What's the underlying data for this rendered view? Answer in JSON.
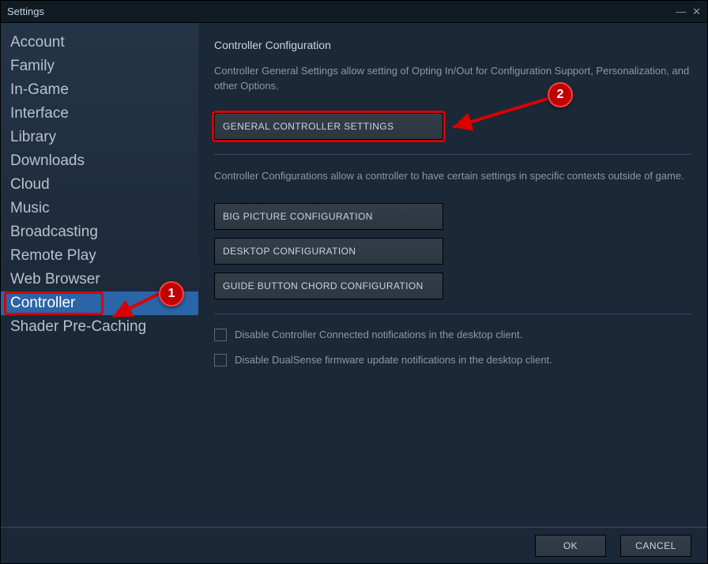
{
  "window": {
    "title": "Settings"
  },
  "sidebar": {
    "items": [
      {
        "label": "Account"
      },
      {
        "label": "Family"
      },
      {
        "label": "In-Game"
      },
      {
        "label": "Interface"
      },
      {
        "label": "Library"
      },
      {
        "label": "Downloads"
      },
      {
        "label": "Cloud"
      },
      {
        "label": "Music"
      },
      {
        "label": "Broadcasting"
      },
      {
        "label": "Remote Play"
      },
      {
        "label": "Web Browser"
      },
      {
        "label": "Controller"
      },
      {
        "label": "Shader Pre-Caching"
      }
    ],
    "selected_index": 11
  },
  "main": {
    "heading": "Controller Configuration",
    "intro": "Controller General Settings allow setting of Opting In/Out for Configuration Support, Personalization, and other Options.",
    "buttons": {
      "general": "GENERAL CONTROLLER SETTINGS",
      "big_picture": "BIG PICTURE CONFIGURATION",
      "desktop": "DESKTOP CONFIGURATION",
      "guide_chord": "GUIDE BUTTON CHORD CONFIGURATION"
    },
    "section_desc": "Controller Configurations allow a controller to have certain settings in specific contexts outside of game.",
    "checkboxes": {
      "disable_connected": "Disable Controller Connected notifications in the desktop client.",
      "disable_dualsense": "Disable DualSense firmware update notifications in the desktop client."
    }
  },
  "footer": {
    "ok": "OK",
    "cancel": "CANCEL"
  },
  "annotations": {
    "step1": "1",
    "step2": "2"
  }
}
